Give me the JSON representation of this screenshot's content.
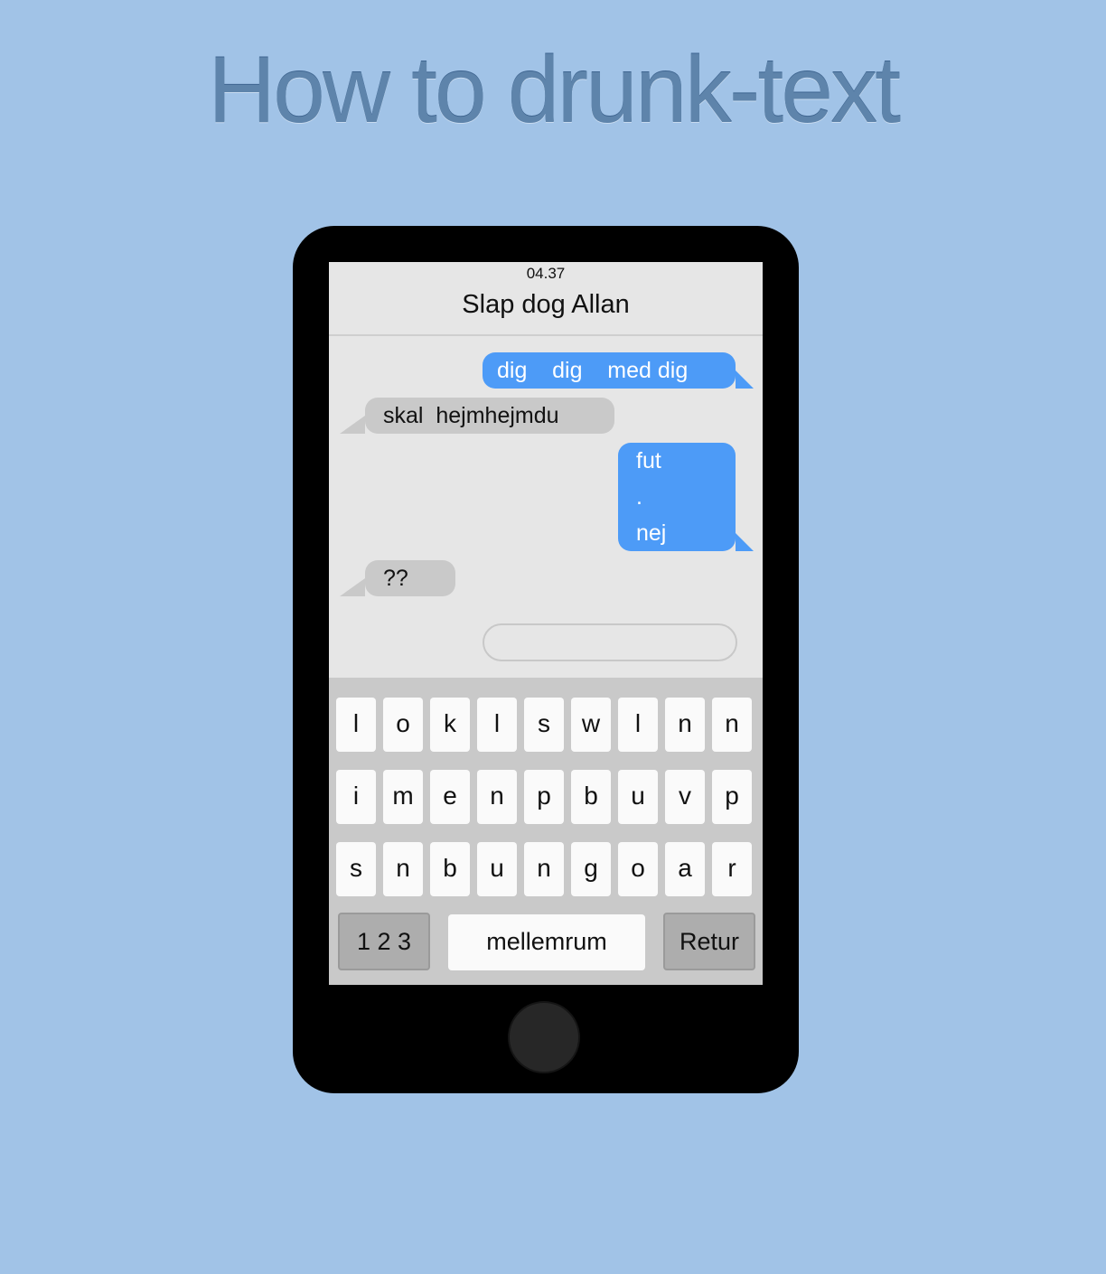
{
  "page": {
    "title": "How to drunk-text"
  },
  "status": {
    "time": "04.37"
  },
  "conversation": {
    "contact": "Slap dog Allan",
    "messages": [
      {
        "from": "me",
        "lines": [
          "dig    dig    med dig"
        ]
      },
      {
        "from": "them",
        "lines": [
          "skal  hejmhejmdu"
        ]
      },
      {
        "from": "me",
        "lines": [
          "fut",
          ".",
          "nej"
        ]
      },
      {
        "from": "them",
        "lines": [
          "??"
        ]
      }
    ]
  },
  "input": {
    "value": ""
  },
  "keyboard": {
    "rows": [
      [
        "l",
        "o",
        "k",
        "l",
        "s",
        "w",
        "l",
        "n",
        "n"
      ],
      [
        "i",
        "m",
        "e",
        "n",
        "p",
        "b",
        "u",
        "v",
        "p"
      ],
      [
        "s",
        "n",
        "b",
        "u",
        "n",
        "g",
        "o",
        "a",
        "r"
      ]
    ],
    "numbers_label": "1 2 3",
    "space_label": "mellemrum",
    "return_label": "Retur"
  },
  "colors": {
    "background": "#a1c3e7",
    "title": "#5e84ab",
    "sent_bubble": "#4d9bf7",
    "received_bubble": "#c9c9c9"
  }
}
